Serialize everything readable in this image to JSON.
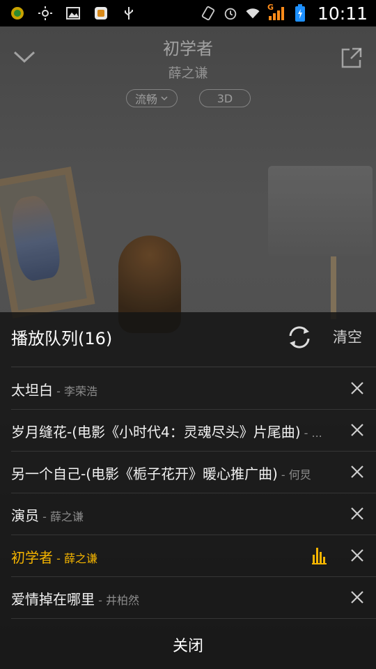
{
  "status_bar": {
    "time": "10:11",
    "left_icons": [
      "app-notify-icon",
      "brightness-icon",
      "image-icon",
      "app-store-icon",
      "usb-icon"
    ],
    "right_icons": [
      "vibrate-icon",
      "alarm-icon",
      "wifi-icon",
      "signal-icon",
      "battery-icon"
    ],
    "network_label": "G"
  },
  "player": {
    "song_title": "初学者",
    "artist": "薛之谦",
    "quality_label": "流畅",
    "mode_label": "3D"
  },
  "queue": {
    "title": "播放队列(16)",
    "clear_label": "清空",
    "close_label": "关闭",
    "accent_color": "#f4b400",
    "items": [
      {
        "name": "太坦白",
        "sep": " - ",
        "artist": "李荣浩",
        "active": false
      },
      {
        "name": "岁月缝花-(电影《小时代4：灵魂尽头》片尾曲)",
        "sep": " - ",
        "artist": "...",
        "active": false
      },
      {
        "name": "另一个自己-(电影《栀子花开》暖心推广曲)",
        "sep": " - ",
        "artist": "何炅",
        "active": false
      },
      {
        "name": "演员",
        "sep": " - ",
        "artist": "薛之谦",
        "active": false
      },
      {
        "name": "初学者",
        "sep": " - ",
        "artist": "薛之谦",
        "active": true
      },
      {
        "name": "爱情掉在哪里",
        "sep": " - ",
        "artist": "井柏然",
        "active": false
      }
    ]
  }
}
